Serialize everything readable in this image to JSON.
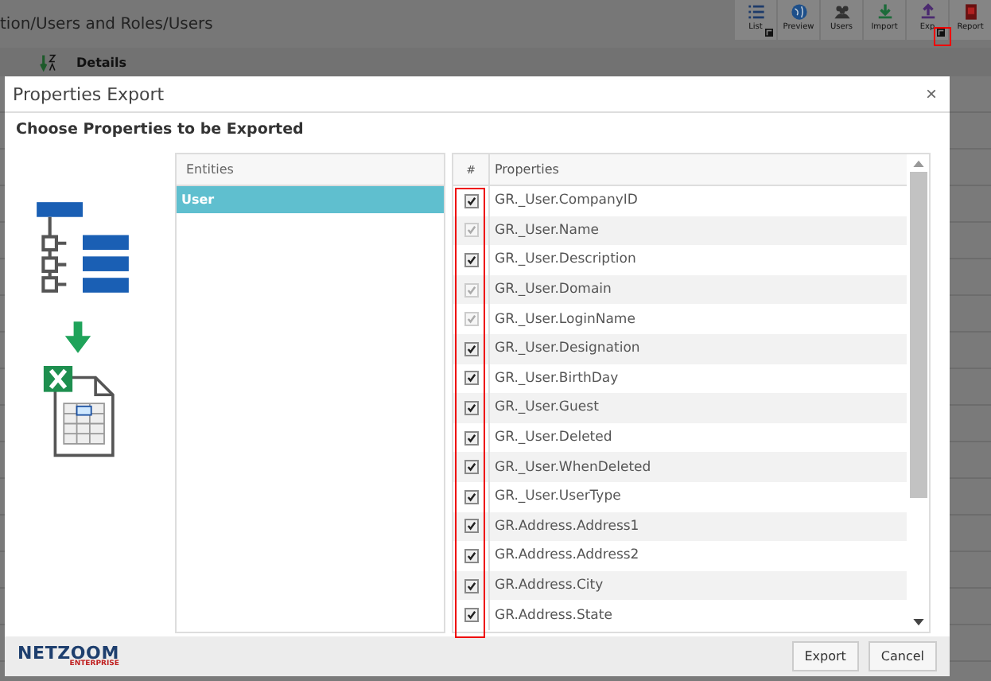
{
  "app": {
    "breadcrumb": "tion/Users and Roles/Users",
    "toolbar": [
      {
        "kind": "list",
        "label": "List",
        "popout": true
      },
      {
        "kind": "preview",
        "label": "Preview",
        "popout": false
      },
      {
        "kind": "users",
        "label": "Users",
        "popout": false
      },
      {
        "kind": "import",
        "label": "Import",
        "popout": false
      },
      {
        "kind": "export",
        "label": "Exp",
        "popout": true
      },
      {
        "kind": "report",
        "label": "Report",
        "popout": false
      }
    ],
    "details_label": "Details"
  },
  "dialog": {
    "title": "Properties Export",
    "close": "×",
    "heading": "Choose Properties to be Exported",
    "entities": {
      "header": "Entities",
      "items": [
        {
          "label": "User",
          "selected": true
        }
      ]
    },
    "properties": {
      "check_header": "#",
      "header": "Properties",
      "rows": [
        {
          "name": "GR._User.CompanyID",
          "checked": true,
          "disabled": false
        },
        {
          "name": "GR._User.Name",
          "checked": true,
          "disabled": true
        },
        {
          "name": "GR._User.Description",
          "checked": true,
          "disabled": false
        },
        {
          "name": "GR._User.Domain",
          "checked": true,
          "disabled": true
        },
        {
          "name": "GR._User.LoginName",
          "checked": true,
          "disabled": true
        },
        {
          "name": "GR._User.Designation",
          "checked": true,
          "disabled": false
        },
        {
          "name": "GR._User.BirthDay",
          "checked": true,
          "disabled": false
        },
        {
          "name": "GR._User.Guest",
          "checked": true,
          "disabled": false
        },
        {
          "name": "GR._User.Deleted",
          "checked": true,
          "disabled": false
        },
        {
          "name": "GR._User.WhenDeleted",
          "checked": true,
          "disabled": false
        },
        {
          "name": "GR._User.UserType",
          "checked": true,
          "disabled": false
        },
        {
          "name": "GR.Address.Address1",
          "checked": true,
          "disabled": false
        },
        {
          "name": "GR.Address.Address2",
          "checked": true,
          "disabled": false
        },
        {
          "name": "GR.Address.City",
          "checked": true,
          "disabled": false
        },
        {
          "name": "GR.Address.State",
          "checked": true,
          "disabled": false
        }
      ]
    },
    "logo": {
      "name": "NETZOOM",
      "tagline": "ENTERPRISE"
    },
    "buttons": [
      "Export",
      "Cancel"
    ]
  }
}
